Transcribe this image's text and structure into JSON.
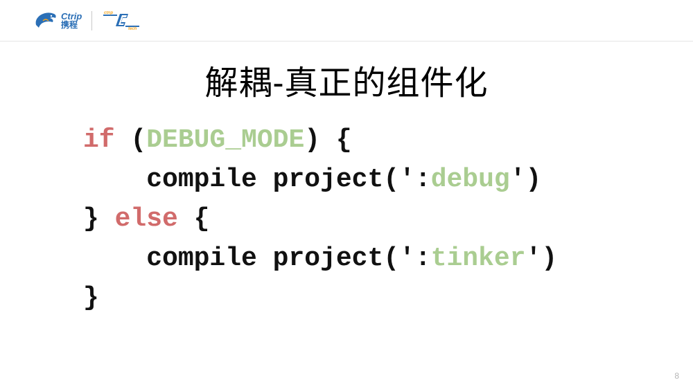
{
  "logo": {
    "ctrip_en": "Ctrip",
    "ctrip_cn": "携程",
    "tech_top": "ctrip",
    "tech_letter": "CT",
    "tech_bottom": "tech"
  },
  "slide": {
    "title": "解耦-真正的组件化",
    "page_number": "8"
  },
  "code": {
    "line1_kw": "if",
    "line1_open": " (",
    "line1_sym": "DEBUG_MODE",
    "line1_close": ") {",
    "line2_txt": "    compile project(':",
    "line2_sym": "debug",
    "line2_end": "')",
    "line3_close": "}",
    "line3_kw": " else ",
    "line3_open": "{",
    "line4_txt": "    compile project(':",
    "line4_sym": "tinker",
    "line4_end": "')",
    "line5": "}"
  }
}
